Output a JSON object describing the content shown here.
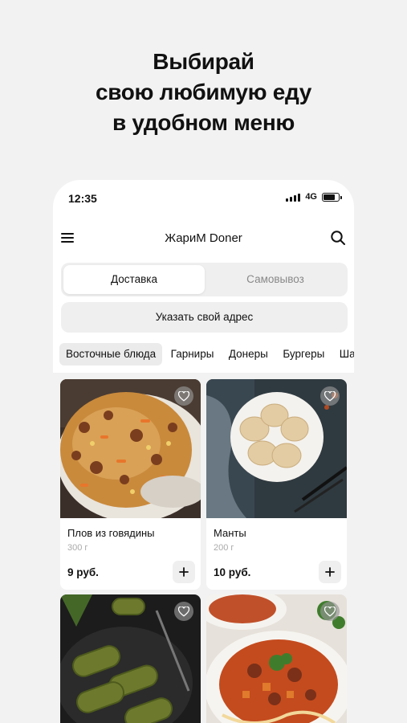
{
  "promo": {
    "line1": "Выбирай",
    "line2": "свою любимую еду",
    "line3": "в удобном меню"
  },
  "status_bar": {
    "time": "12:35",
    "network": "4G",
    "icons": [
      "signal-icon",
      "battery-icon"
    ]
  },
  "app_bar": {
    "title": "ЖариМ Doner",
    "icons": [
      "menu-icon",
      "search-icon"
    ]
  },
  "delivery_toggle": {
    "options": [
      "Доставка",
      "Самовывоз"
    ],
    "selected": "Доставка"
  },
  "address_button": "Указать свой адрес",
  "categories": {
    "items": [
      "Восточные блюда",
      "Гарниры",
      "Донеры",
      "Бургеры",
      "Шаурма"
    ],
    "selected": "Восточные блюда"
  },
  "products": [
    {
      "name": "Плов из говядины",
      "weight": "300 г",
      "price": "9 руб.",
      "image": "plov-photo"
    },
    {
      "name": "Манты",
      "weight": "200 г",
      "price": "10 руб.",
      "image": "manty-photo"
    },
    {
      "name": "",
      "weight": "",
      "price": "",
      "image": "dolma-photo"
    },
    {
      "name": "",
      "weight": "",
      "price": "",
      "image": "lagman-photo"
    }
  ],
  "colors": {
    "background": "#f2f2f2",
    "surface": "#ffffff",
    "chip": "#efefef",
    "text": "#111111",
    "muted": "#aaaaaa"
  }
}
